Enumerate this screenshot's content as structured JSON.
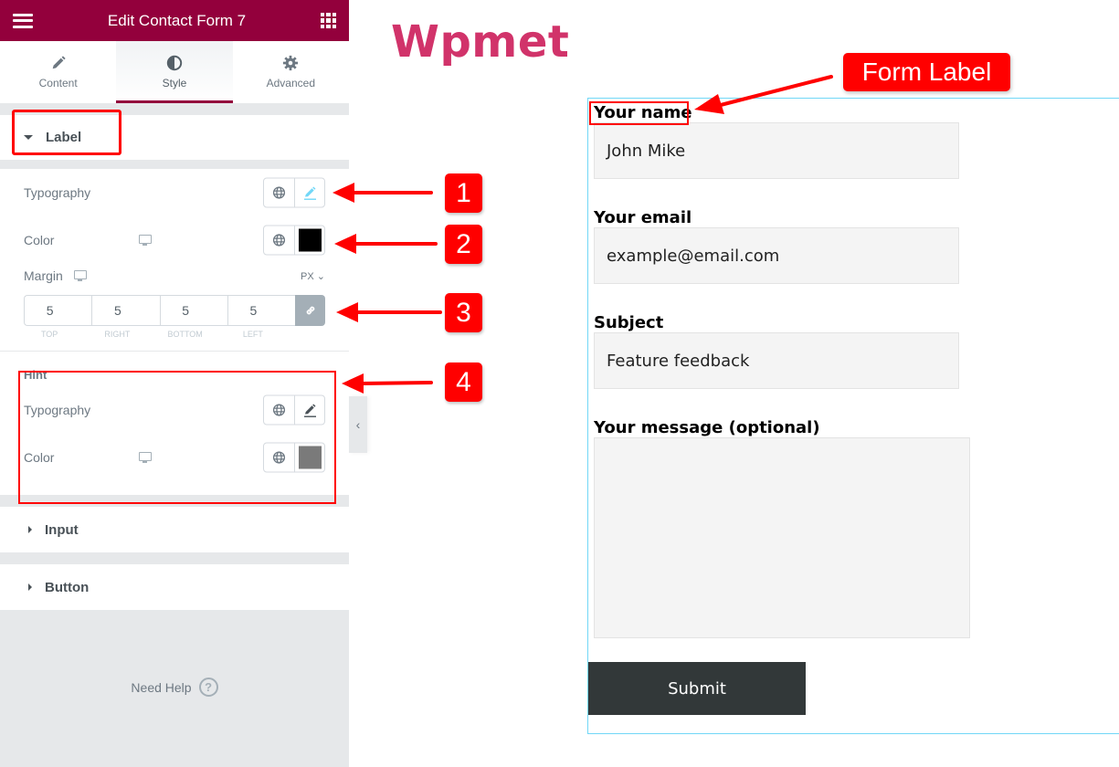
{
  "panel": {
    "title": "Edit Contact Form 7",
    "menu_icon": "hamburger-icon",
    "apps_icon": "grid-icon",
    "accent": "#93003c",
    "tabs": [
      {
        "label": "Content",
        "icon": "pencil-icon",
        "active": false
      },
      {
        "label": "Style",
        "icon": "contrast-icon",
        "active": true
      },
      {
        "label": "Advanced",
        "icon": "gear-icon",
        "active": false
      }
    ],
    "label_section": {
      "title": "Label",
      "expanded": true,
      "typography_label": "Typography",
      "color_label": "Color",
      "color_value": "#000000",
      "margin": {
        "label": "Margin",
        "unit": "PX",
        "values": [
          "5",
          "5",
          "5",
          "5"
        ],
        "sides": [
          "TOP",
          "RIGHT",
          "BOTTOM",
          "LEFT"
        ],
        "linked": true
      }
    },
    "hint_section": {
      "title": "Hint",
      "typography_label": "Typography",
      "color_label": "Color",
      "color_value": "#7a7a7a"
    },
    "input_section": {
      "title": "Input",
      "expanded": false
    },
    "button_section": {
      "title": "Button",
      "expanded": false
    },
    "need_help": "Need Help",
    "help_icon": "?",
    "collapse_icon": "‹"
  },
  "annotations": {
    "badges": [
      "1",
      "2",
      "3",
      "4"
    ],
    "callout": "Form Label",
    "color": "#ff0000"
  },
  "preview": {
    "brand": "Wpmet",
    "brand_color": "#d1336a",
    "fields": [
      {
        "label": "Your name",
        "value": "John Mike"
      },
      {
        "label": "Your email",
        "value": "example@email.com"
      },
      {
        "label": "Subject",
        "value": "Feature feedback"
      },
      {
        "label": "Your message (optional)",
        "value": ""
      }
    ],
    "submit_label": "Submit"
  }
}
